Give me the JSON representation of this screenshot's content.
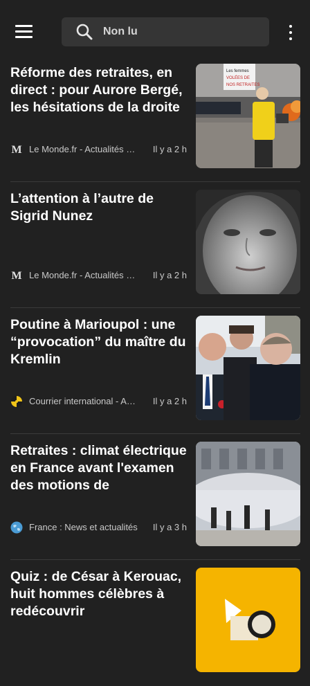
{
  "search": {
    "label": "Non lu",
    "icon": "search-icon"
  },
  "toolbar": {
    "menu_icon": "hamburger-menu-icon",
    "more_icon": "more-vert-icon"
  },
  "articles": [
    {
      "title": "Réforme des retraites, en direct : pour Aurore Bergé, les hésitations de la droite",
      "source": "Le Monde.fr - Actualités et Infos",
      "time": "Il y a 2 h",
      "source_icon": "le-monde-logo-icon",
      "thumb_text": "Les femmes VOLÉES DE NOS RETRAITES"
    },
    {
      "title": "L’attention à l’autre de Sigrid Nunez",
      "source": "Le Monde.fr - Actualités et Infos",
      "time": "Il y a 2 h",
      "source_icon": "le-monde-logo-icon"
    },
    {
      "title": "Poutine à Marioupol : une “provocation” du maître du Kremlin",
      "source": "Courrier international - Actualités",
      "time": "Il y a 2 h",
      "source_icon": "courrier-international-logo-icon"
    },
    {
      "title": "Retraites : climat électrique en France avant l'examen des motions de",
      "source": "France : News et actualités",
      "time": "Il y a 3 h",
      "source_icon": "globe-logo-icon"
    },
    {
      "title": "Quiz : de César à Kerouac, huit hommes célèbres à redécouvrir",
      "source": "",
      "time": "",
      "source_icon": ""
    }
  ],
  "colors": {
    "background": "#212121",
    "search_bg": "#353535",
    "divider": "#3b3b3b",
    "meta_text": "#c9c9c9",
    "quiz_thumb": "#f5b400"
  }
}
